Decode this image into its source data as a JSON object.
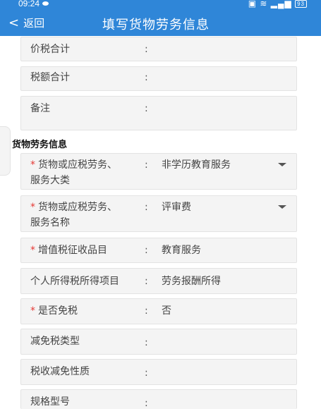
{
  "statusbar": {
    "time": "09:24",
    "battery": "93"
  },
  "navbar": {
    "back_label": "返回",
    "title": "填写货物劳务信息"
  },
  "fields_top": [
    {
      "label": "价税合计",
      "colon": ":",
      "value": ""
    },
    {
      "label": "税额合计",
      "colon": ":",
      "value": ""
    },
    {
      "label": "备注",
      "colon": ":",
      "value": ""
    }
  ],
  "section": {
    "title": "货物劳务信息"
  },
  "fields": [
    {
      "required": "*",
      "label_line1": "货物或应税劳务、",
      "label_line2": "服务大类",
      "colon": ":",
      "value": "非学历教育服务"
    },
    {
      "required": "*",
      "label_line1": "货物或应税劳务、",
      "label_line2": "服务名称",
      "colon": ":",
      "value": "评审费"
    },
    {
      "required": "*",
      "label": "增值税征收品目",
      "colon": ":",
      "value": "教育服务"
    },
    {
      "label": "个人所得税所得项目",
      "colon": ":",
      "value": "劳务报酬所得"
    },
    {
      "required": "*",
      "label": "是否免税",
      "colon": ":",
      "value": "否"
    },
    {
      "label": "减免税类型",
      "colon": ":",
      "value": ""
    },
    {
      "label": "税收减免性质",
      "colon": ":",
      "value": ""
    },
    {
      "label": "规格型号",
      "colon": ":",
      "value": ""
    }
  ]
}
